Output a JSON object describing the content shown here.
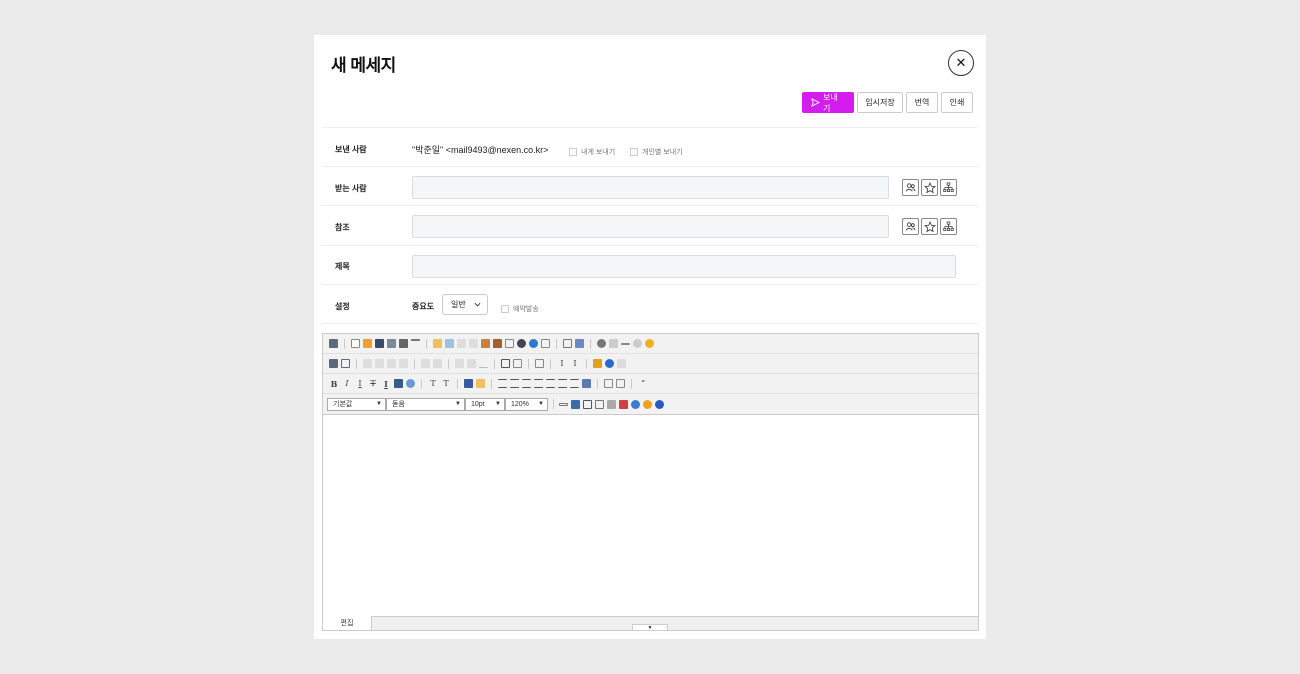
{
  "dialog": {
    "title": "새 메세지",
    "close_label": "✕"
  },
  "actions": {
    "send": "보내기",
    "draft": "임시저장",
    "translate": "번역",
    "print": "인쇄"
  },
  "form": {
    "sender_label": "보낸 사람",
    "sender_value": "\"박준일\" <mail9493@nexen.co.kr>",
    "send_to_self": "내게 보내기",
    "send_individually": "개인별 보내기",
    "to_label": "받는 사람",
    "cc_label": "참조",
    "subject_label": "제목",
    "settings_label": "설정",
    "importance_label": "중요도",
    "importance_value": "일반",
    "schedule_label": "예약발송"
  },
  "editor": {
    "font_style": "기본값",
    "font_family": "돋움",
    "font_size": "10pt",
    "line_height": "120%",
    "tab_edit": "편집"
  },
  "colors": {
    "primary": "#d41cf0"
  }
}
